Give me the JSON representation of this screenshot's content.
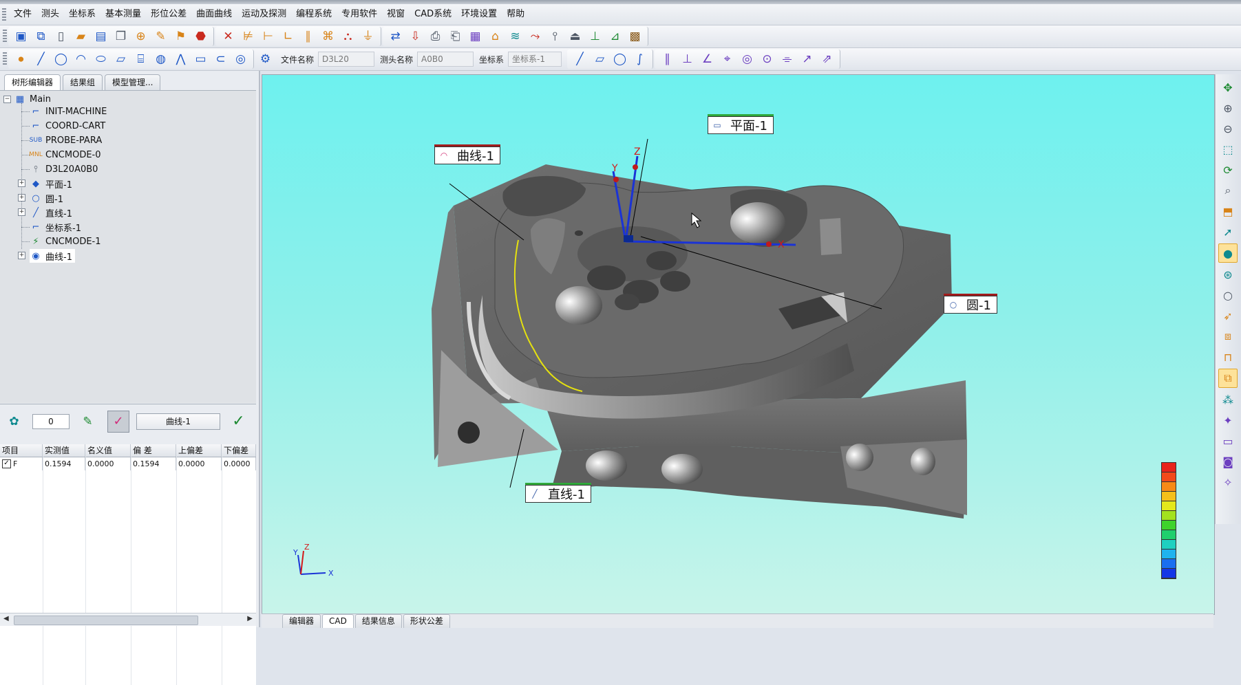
{
  "menubar": {
    "items": [
      "文件",
      "测头",
      "坐标系",
      "基本测量",
      "形位公差",
      "曲面曲线",
      "运动及探测",
      "编程系统",
      "专用软件",
      "视窗",
      "CAD系统",
      "环境设置",
      "帮助"
    ]
  },
  "toolbar2": {
    "file_label": "文件名称",
    "file_value": "D3L20",
    "probe_label": "测头名称",
    "probe_value": "A0B0",
    "coord_label": "坐标系",
    "coord_value": "坐标系-1"
  },
  "left_tabs": [
    "树形编辑器",
    "结果组",
    "模型管理..."
  ],
  "tree": {
    "root": "Main",
    "items": [
      {
        "label": "INIT-MACHINE",
        "icon": "coord-icon"
      },
      {
        "label": "COORD-CART",
        "icon": "coord-icon"
      },
      {
        "label": "PROBE-PARA",
        "icon": "sub-icon"
      },
      {
        "label": "CNCMODE-0",
        "icon": "mnl-icon"
      },
      {
        "label": "D3L20A0B0",
        "icon": "probe-icon"
      },
      {
        "label": "平面-1",
        "icon": "plane-icon"
      },
      {
        "label": "圆-1",
        "icon": "circle-icon"
      },
      {
        "label": "直线-1",
        "icon": "line-icon"
      },
      {
        "label": "坐标系-1",
        "icon": "coord-icon"
      },
      {
        "label": "CNCMODE-1",
        "icon": "cnc-icon"
      },
      {
        "label": "曲线-1",
        "icon": "curve-icon"
      }
    ]
  },
  "eval": {
    "number": "0",
    "feature_name": "曲线-1"
  },
  "measure_table": {
    "headers": [
      "项目",
      "实测值",
      "名义值",
      "偏 差",
      "上偏差",
      "下偏差"
    ],
    "rows": [
      {
        "item": "F",
        "checked": true,
        "measured": "0.1594",
        "nominal": "0.0000",
        "deviation": "0.1594",
        "upper": "0.0000",
        "lower": "0.0000"
      }
    ]
  },
  "viewport": {
    "callouts": {
      "plane": "平面-1",
      "curve": "曲线-1",
      "circle": "圆-1",
      "line": "直线-1"
    },
    "axis_labels": {
      "x": "X",
      "y": "Y",
      "z": "Z"
    },
    "triad_labels": {
      "x": "X",
      "y": "Y",
      "z": "Z"
    },
    "color_scale": [
      "#e8231b",
      "#f24a1a",
      "#f78a16",
      "#f4c01a",
      "#e4e81b",
      "#a3e21e",
      "#3ed32b",
      "#1fcf6d",
      "#1fd0c0",
      "#1fb3ee",
      "#1a6ff0",
      "#1437e6"
    ]
  },
  "bottom_tabs": [
    "编辑器",
    "CAD",
    "结果信息",
    "形状公差"
  ],
  "colors": {
    "accent": "#1f58c6",
    "curve": "#e5e10f"
  }
}
